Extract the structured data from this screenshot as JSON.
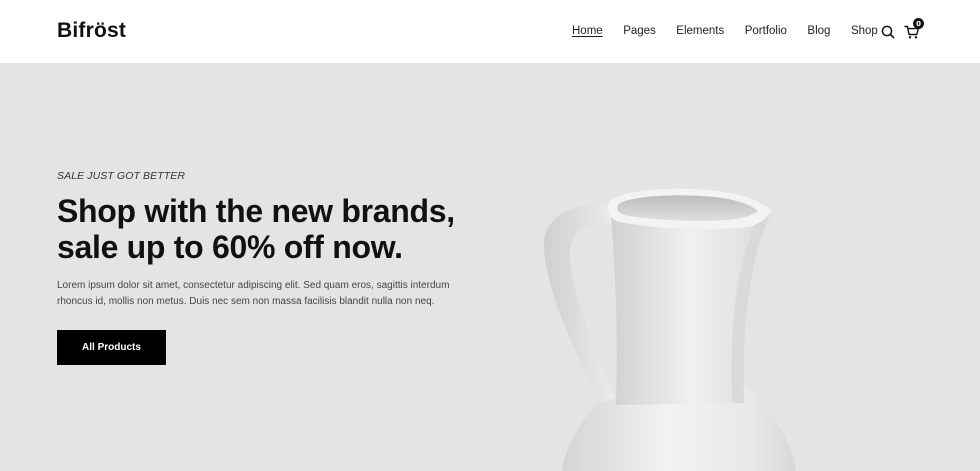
{
  "header": {
    "logo": "Bifröst",
    "nav": [
      "Home",
      "Pages",
      "Elements",
      "Portfolio",
      "Blog",
      "Shop"
    ],
    "active_nav": "Home",
    "cart_count": "0",
    "icons": [
      "search-icon",
      "cart-icon"
    ]
  },
  "hero": {
    "eyebrow": "SALE JUST GOT BETTER",
    "headline_line1": "Shop with the new brands,",
    "headline_line2": "sale up to 60% off now.",
    "description_line1": "Lorem ipsum dolor sit amet, consectetur adipiscing elit. Sed quam eros, sagittis interdum",
    "description_line2": "rhoncus id, mollis non metus. Duis nec sem non massa facilisis blandit nulla non neq.",
    "cta_label": "All Products",
    "image": "white-ceramic-jug"
  },
  "colors": {
    "hero_bg": "#e4e4e4",
    "header_bg": "#ffffff",
    "button_bg": "#000000",
    "text": "#111111"
  }
}
